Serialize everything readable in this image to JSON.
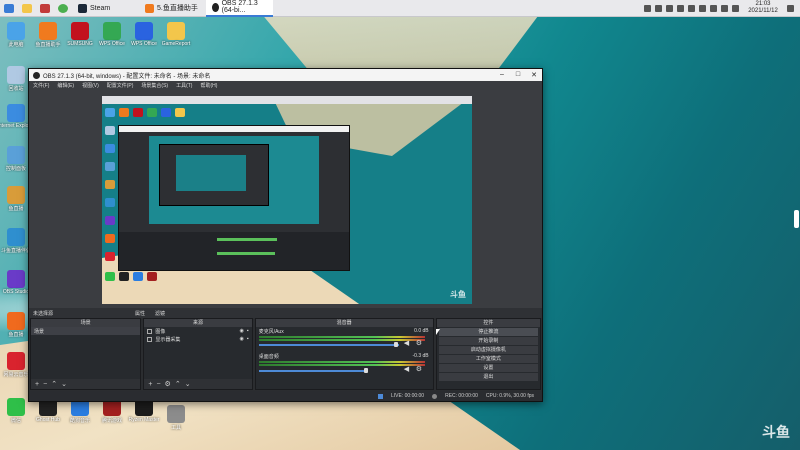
{
  "taskbar": {
    "items": [
      {
        "label": "Steam"
      },
      {
        "label": "5.鱼直播助手"
      },
      {
        "label": "OBS 27.1.3 (64-bi..."
      }
    ],
    "clock_time": "21:03",
    "clock_date": "2021/11/12"
  },
  "desktop": {
    "icons": [
      {
        "label": "此电脑",
        "color": "#4aa3e8"
      },
      {
        "label": "鱼直播助手",
        "color": "#f07a1e"
      },
      {
        "label": "SUMSUNG",
        "color": "#c2121e"
      },
      {
        "label": "WPS Office",
        "color": "#34a853"
      },
      {
        "label": "WPS Office",
        "color": "#2a63e0"
      },
      {
        "label": "GameReport",
        "color": "#f3c64b"
      },
      {
        "label": "回收站",
        "color": "#b0c9e3"
      },
      {
        "label": "Internet Explorer",
        "color": "#3b8ce0"
      },
      {
        "label": "控制面板",
        "color": "#5aa0d8"
      },
      {
        "label": "鱼直播",
        "color": "#d89c3a"
      },
      {
        "label": "斗鱼直播伴侣",
        "color": "#2f8fcf"
      },
      {
        "label": "OBS Studio",
        "color": "#6a3bc8"
      },
      {
        "label": "鱼直播",
        "color": "#f06a1e"
      },
      {
        "label": "网易云音乐",
        "color": "#d9232e"
      },
      {
        "label": "微信",
        "color": "#2fbf49"
      },
      {
        "label": "Ghost Hub",
        "color": "#222222"
      },
      {
        "label": "酷狗音乐",
        "color": "#2a7de1"
      },
      {
        "label": "腾讯游戏",
        "color": "#a32020"
      },
      {
        "label": "Ryzen Master",
        "color": "#1c1c1c"
      },
      {
        "label": "工具",
        "color": "#8c8c8c"
      }
    ],
    "watermark": "斗鱼"
  },
  "obs": {
    "title": "OBS 27.1.3 (64-bit, windows) - 配置文件: 未命名 - 场景: 未命名",
    "menu": [
      "文件(F)",
      "编辑(E)",
      "视图(V)",
      "配置文件(P)",
      "场景集合(S)",
      "工具(T)",
      "帮助(H)"
    ],
    "dock_left": "未选择源",
    "dock_props": "属性",
    "dock_filters": "滤镜",
    "panels": {
      "scenes": {
        "title": "场景",
        "items": [
          "场景"
        ]
      },
      "sources": {
        "title": "来源",
        "items": [
          "图像",
          "显示器采集"
        ]
      },
      "mixer": {
        "title": "混音器",
        "channels": [
          {
            "name": "麦克风/Aux",
            "db": "0.0 dB"
          },
          {
            "name": "桌面音频",
            "db": "-0.3 dB"
          }
        ]
      },
      "controls": {
        "title": "控件",
        "buttons": [
          "停止推流",
          "开始录制",
          "启动虚拟摄像机",
          "工作室模式",
          "设置",
          "退出"
        ]
      }
    },
    "status": {
      "live": "LIVE: 00:00:00",
      "rec": "REC: 00:00:00",
      "cpu": "CPU: 0.9%, 30.00 fps"
    }
  },
  "colors": {
    "accent": "#3a7bd5",
    "obs_bg": "#2b2d30"
  }
}
